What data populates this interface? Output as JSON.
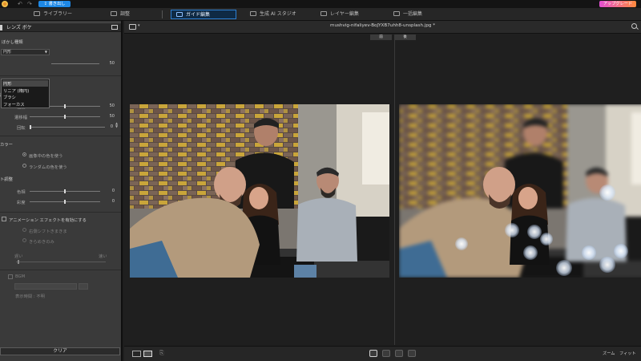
{
  "topbar": {
    "export_label": "書き出し",
    "upgrade_label": "アップグレード"
  },
  "tabs": [
    {
      "label": "ライブラリー"
    },
    {
      "label": "調整"
    },
    {
      "label": "ガイド編集"
    },
    {
      "label": "生成 AI スタジオ"
    },
    {
      "label": "レイヤー編集"
    },
    {
      "label": "一括編集"
    }
  ],
  "panel": {
    "title": "レンズ ボケ",
    "blur_type_label": "ぼかし種類",
    "blur_type_value": "円形",
    "blur_type_options": [
      "円形",
      "リニア (楕円)",
      "ブラシ",
      "フォーカス"
    ],
    "dropdown_row_value": "50",
    "settings_label": "設定",
    "sliders": [
      {
        "label": "強度",
        "value": "50",
        "fraction": 0.5
      },
      {
        "label": "遷移幅",
        "value": "50",
        "fraction": 0.5
      },
      {
        "label": "回転",
        "value": "0",
        "fraction": 0.0
      }
    ],
    "color_label": "カラー",
    "color_options": [
      "画像中の色を使う",
      "ランダムの色を使う"
    ],
    "adjust_label": "ト調整",
    "adjust_sliders": [
      {
        "label": "色相",
        "value": "0",
        "fraction": 0.5
      },
      {
        "label": "彩度",
        "value": "0",
        "fraction": 0.5
      }
    ],
    "animation_label": "アニメーション エフェクトを有効にする",
    "animation_options": [
      "右側シフトきまきま",
      "きらめきのみ"
    ],
    "speed_slow": "遅い",
    "speed_fast": "速い",
    "bgm_label": "BGM",
    "duration_label": "表示時間 : 不明",
    "clear_label": "クリア"
  },
  "workspace": {
    "file_name": "mushvig-nifaliyev-BoJYXB7uhh8-unsplash.jpg *",
    "before_label": "前",
    "after_label": "後",
    "zoom_label": "ズーム",
    "fit_label": "フィット"
  },
  "colors": {
    "accent": "#1e88e5",
    "active_tab_border": "#2d7fd1",
    "panel_bg": "#3a3a3a",
    "workspace_bg": "#1f1f1f"
  }
}
